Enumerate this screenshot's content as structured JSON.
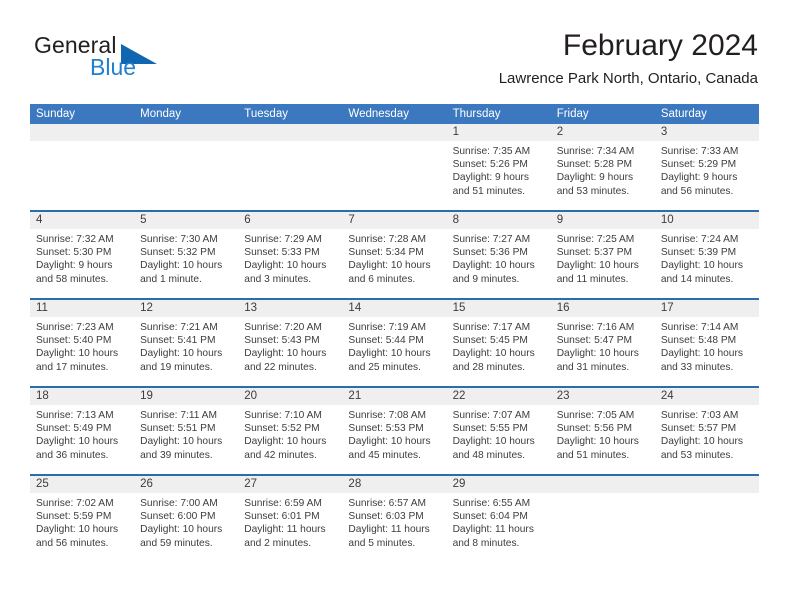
{
  "brand": {
    "name_dark": "General",
    "name_blue": "Blue",
    "accent_blue": "#1f7fd0",
    "triangle_blue": "#1066b0"
  },
  "header": {
    "title": "February 2024",
    "subtitle": "Lawrence Park North, Ontario, Canada",
    "header_bar_color": "#3b78c0",
    "week_divider_color": "#2b6cab",
    "day_number_band_color": "#efefef"
  },
  "calendar": {
    "day_headers": [
      "Sunday",
      "Monday",
      "Tuesday",
      "Wednesday",
      "Thursday",
      "Friday",
      "Saturday"
    ],
    "weeks": [
      [
        {
          "day": "",
          "lines": []
        },
        {
          "day": "",
          "lines": []
        },
        {
          "day": "",
          "lines": []
        },
        {
          "day": "",
          "lines": []
        },
        {
          "day": "1",
          "lines": [
            "Sunrise: 7:35 AM",
            "Sunset: 5:26 PM",
            "Daylight: 9 hours",
            "and 51 minutes."
          ]
        },
        {
          "day": "2",
          "lines": [
            "Sunrise: 7:34 AM",
            "Sunset: 5:28 PM",
            "Daylight: 9 hours",
            "and 53 minutes."
          ]
        },
        {
          "day": "3",
          "lines": [
            "Sunrise: 7:33 AM",
            "Sunset: 5:29 PM",
            "Daylight: 9 hours",
            "and 56 minutes."
          ]
        }
      ],
      [
        {
          "day": "4",
          "lines": [
            "Sunrise: 7:32 AM",
            "Sunset: 5:30 PM",
            "Daylight: 9 hours",
            "and 58 minutes."
          ]
        },
        {
          "day": "5",
          "lines": [
            "Sunrise: 7:30 AM",
            "Sunset: 5:32 PM",
            "Daylight: 10 hours",
            "and 1 minute."
          ]
        },
        {
          "day": "6",
          "lines": [
            "Sunrise: 7:29 AM",
            "Sunset: 5:33 PM",
            "Daylight: 10 hours",
            "and 3 minutes."
          ]
        },
        {
          "day": "7",
          "lines": [
            "Sunrise: 7:28 AM",
            "Sunset: 5:34 PM",
            "Daylight: 10 hours",
            "and 6 minutes."
          ]
        },
        {
          "day": "8",
          "lines": [
            "Sunrise: 7:27 AM",
            "Sunset: 5:36 PM",
            "Daylight: 10 hours",
            "and 9 minutes."
          ]
        },
        {
          "day": "9",
          "lines": [
            "Sunrise: 7:25 AM",
            "Sunset: 5:37 PM",
            "Daylight: 10 hours",
            "and 11 minutes."
          ]
        },
        {
          "day": "10",
          "lines": [
            "Sunrise: 7:24 AM",
            "Sunset: 5:39 PM",
            "Daylight: 10 hours",
            "and 14 minutes."
          ]
        }
      ],
      [
        {
          "day": "11",
          "lines": [
            "Sunrise: 7:23 AM",
            "Sunset: 5:40 PM",
            "Daylight: 10 hours",
            "and 17 minutes."
          ]
        },
        {
          "day": "12",
          "lines": [
            "Sunrise: 7:21 AM",
            "Sunset: 5:41 PM",
            "Daylight: 10 hours",
            "and 19 minutes."
          ]
        },
        {
          "day": "13",
          "lines": [
            "Sunrise: 7:20 AM",
            "Sunset: 5:43 PM",
            "Daylight: 10 hours",
            "and 22 minutes."
          ]
        },
        {
          "day": "14",
          "lines": [
            "Sunrise: 7:19 AM",
            "Sunset: 5:44 PM",
            "Daylight: 10 hours",
            "and 25 minutes."
          ]
        },
        {
          "day": "15",
          "lines": [
            "Sunrise: 7:17 AM",
            "Sunset: 5:45 PM",
            "Daylight: 10 hours",
            "and 28 minutes."
          ]
        },
        {
          "day": "16",
          "lines": [
            "Sunrise: 7:16 AM",
            "Sunset: 5:47 PM",
            "Daylight: 10 hours",
            "and 31 minutes."
          ]
        },
        {
          "day": "17",
          "lines": [
            "Sunrise: 7:14 AM",
            "Sunset: 5:48 PM",
            "Daylight: 10 hours",
            "and 33 minutes."
          ]
        }
      ],
      [
        {
          "day": "18",
          "lines": [
            "Sunrise: 7:13 AM",
            "Sunset: 5:49 PM",
            "Daylight: 10 hours",
            "and 36 minutes."
          ]
        },
        {
          "day": "19",
          "lines": [
            "Sunrise: 7:11 AM",
            "Sunset: 5:51 PM",
            "Daylight: 10 hours",
            "and 39 minutes."
          ]
        },
        {
          "day": "20",
          "lines": [
            "Sunrise: 7:10 AM",
            "Sunset: 5:52 PM",
            "Daylight: 10 hours",
            "and 42 minutes."
          ]
        },
        {
          "day": "21",
          "lines": [
            "Sunrise: 7:08 AM",
            "Sunset: 5:53 PM",
            "Daylight: 10 hours",
            "and 45 minutes."
          ]
        },
        {
          "day": "22",
          "lines": [
            "Sunrise: 7:07 AM",
            "Sunset: 5:55 PM",
            "Daylight: 10 hours",
            "and 48 minutes."
          ]
        },
        {
          "day": "23",
          "lines": [
            "Sunrise: 7:05 AM",
            "Sunset: 5:56 PM",
            "Daylight: 10 hours",
            "and 51 minutes."
          ]
        },
        {
          "day": "24",
          "lines": [
            "Sunrise: 7:03 AM",
            "Sunset: 5:57 PM",
            "Daylight: 10 hours",
            "and 53 minutes."
          ]
        }
      ],
      [
        {
          "day": "25",
          "lines": [
            "Sunrise: 7:02 AM",
            "Sunset: 5:59 PM",
            "Daylight: 10 hours",
            "and 56 minutes."
          ]
        },
        {
          "day": "26",
          "lines": [
            "Sunrise: 7:00 AM",
            "Sunset: 6:00 PM",
            "Daylight: 10 hours",
            "and 59 minutes."
          ]
        },
        {
          "day": "27",
          "lines": [
            "Sunrise: 6:59 AM",
            "Sunset: 6:01 PM",
            "Daylight: 11 hours",
            "and 2 minutes."
          ]
        },
        {
          "day": "28",
          "lines": [
            "Sunrise: 6:57 AM",
            "Sunset: 6:03 PM",
            "Daylight: 11 hours",
            "and 5 minutes."
          ]
        },
        {
          "day": "29",
          "lines": [
            "Sunrise: 6:55 AM",
            "Sunset: 6:04 PM",
            "Daylight: 11 hours",
            "and 8 minutes."
          ]
        },
        {
          "day": "",
          "lines": []
        },
        {
          "day": "",
          "lines": []
        }
      ]
    ]
  }
}
